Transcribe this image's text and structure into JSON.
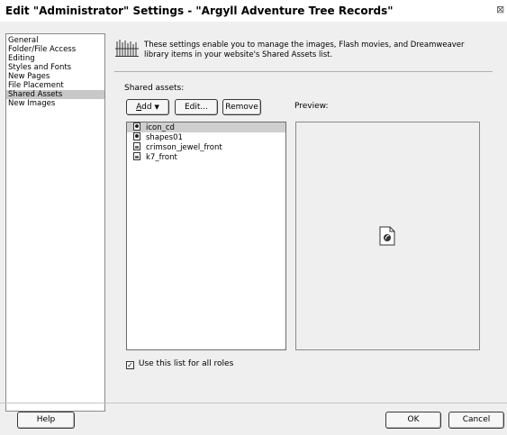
{
  "window": {
    "title": "Edit \"Administrator\" Settings - \"Argyll Adventure Tree Records\"",
    "close_glyph": "⊠"
  },
  "categories": {
    "items": [
      {
        "label": "General"
      },
      {
        "label": "Folder/File Access"
      },
      {
        "label": "Editing"
      },
      {
        "label": "Styles and Fonts"
      },
      {
        "label": "New Pages"
      },
      {
        "label": "File Placement"
      },
      {
        "label": "Shared Assets"
      },
      {
        "label": "New Images"
      }
    ],
    "selected": "Shared Assets"
  },
  "panel": {
    "icon": "library-icon",
    "description": "These settings enable you to manage the images, Flash movies, and Dreamweaver library items in your website's Shared Assets list.",
    "shared_assets_label": "Shared assets:",
    "preview_label": "Preview:",
    "buttons": {
      "add_underline": "A",
      "add_rest": "dd",
      "add_arrow": "▼",
      "edit": "Edit...",
      "remove": "Remove"
    },
    "assets": [
      {
        "name": "icon_cd",
        "icon": "flash-icon",
        "selected": true
      },
      {
        "name": "shapes01",
        "icon": "flash-icon",
        "selected": false
      },
      {
        "name": "crimson_jewel_front",
        "icon": "image-icon",
        "selected": false
      },
      {
        "name": "k7_front",
        "icon": "image-icon",
        "selected": false
      }
    ],
    "preview_icon": "flash-file-icon",
    "use_list_checkbox": {
      "label": "Use this list for all roles",
      "checked": true,
      "check_glyph": "✓"
    }
  },
  "footer": {
    "help": "Help",
    "ok": "OK",
    "cancel": "Cancel"
  }
}
